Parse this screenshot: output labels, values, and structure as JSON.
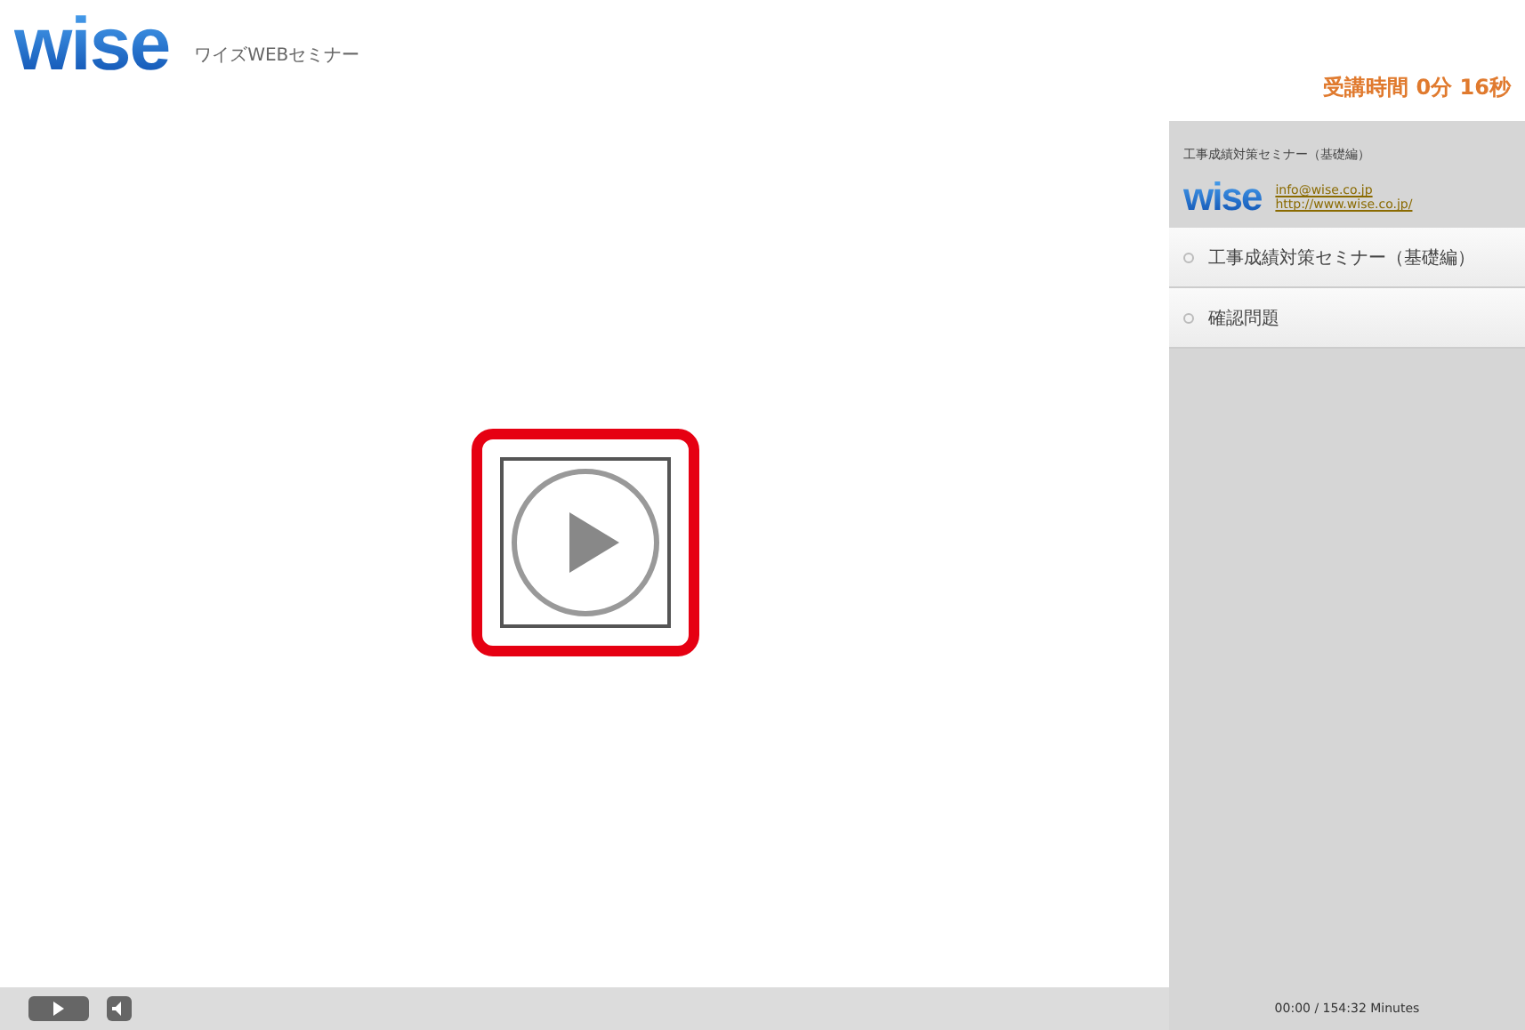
{
  "header": {
    "logo": "wise",
    "subtitle": "ワイズWEBセミナー",
    "elapsed": "受講時間 0分 16秒"
  },
  "player": {
    "highlighted": true
  },
  "sidebar": {
    "title": "工事成績対策セミナー（基礎編）",
    "logo": "wise",
    "links": [
      "info@wise.co.jp",
      "http://www.wise.co.jp/"
    ],
    "items": [
      {
        "label": "工事成績対策セミナー（基礎編）",
        "selected": false
      },
      {
        "label": "確認問題",
        "selected": false
      }
    ],
    "duration": "00:00 / 154:32 Minutes"
  }
}
